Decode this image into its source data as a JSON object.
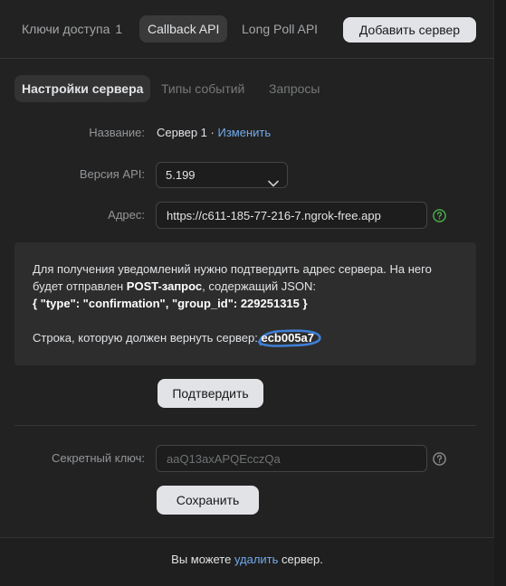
{
  "top_tabs": {
    "access_keys": "Ключи доступа",
    "access_keys_count": "1",
    "callback_api": "Callback API",
    "long_poll_api": "Long Poll API",
    "add_server": "Добавить сервер"
  },
  "sub_tabs": {
    "server_settings": "Настройки сервера",
    "event_types": "Типы событий",
    "requests": "Запросы"
  },
  "form": {
    "name_label": "Название:",
    "name_value": "Сервер 1 · ",
    "name_edit": "Изменить",
    "api_version_label": "Версия API:",
    "api_version_value": "5.199",
    "address_label": "Адрес:",
    "address_value": "https://c611-185-77-216-7.ngrok-free.app",
    "secret_label": "Секретный ключ:",
    "secret_placeholder": "aaQ13axAPQEcczQa"
  },
  "notice": {
    "line1": "Для получения уведомлений нужно подтвердить адрес сервера. На него",
    "line2_pre": "будет отправлен ",
    "line2_bold": "POST-запрос",
    "line2_post": ", содержащий JSON:",
    "line3": "{ \"type\": \"confirmation\", \"group_id\": 229251315 }",
    "line4_pre": "Строка, которую должен вернуть сервер: ",
    "confirm_code": "ecb005a7"
  },
  "buttons": {
    "confirm": "Подтвердить",
    "save": "Сохранить"
  },
  "footer": {
    "pre": "Вы можете ",
    "link": "удалить",
    "post": " сервер."
  },
  "colors": {
    "accent_link": "#71aaeb",
    "highlight_scribble": "#3f7fd6",
    "help_green": "#4bb34b"
  }
}
